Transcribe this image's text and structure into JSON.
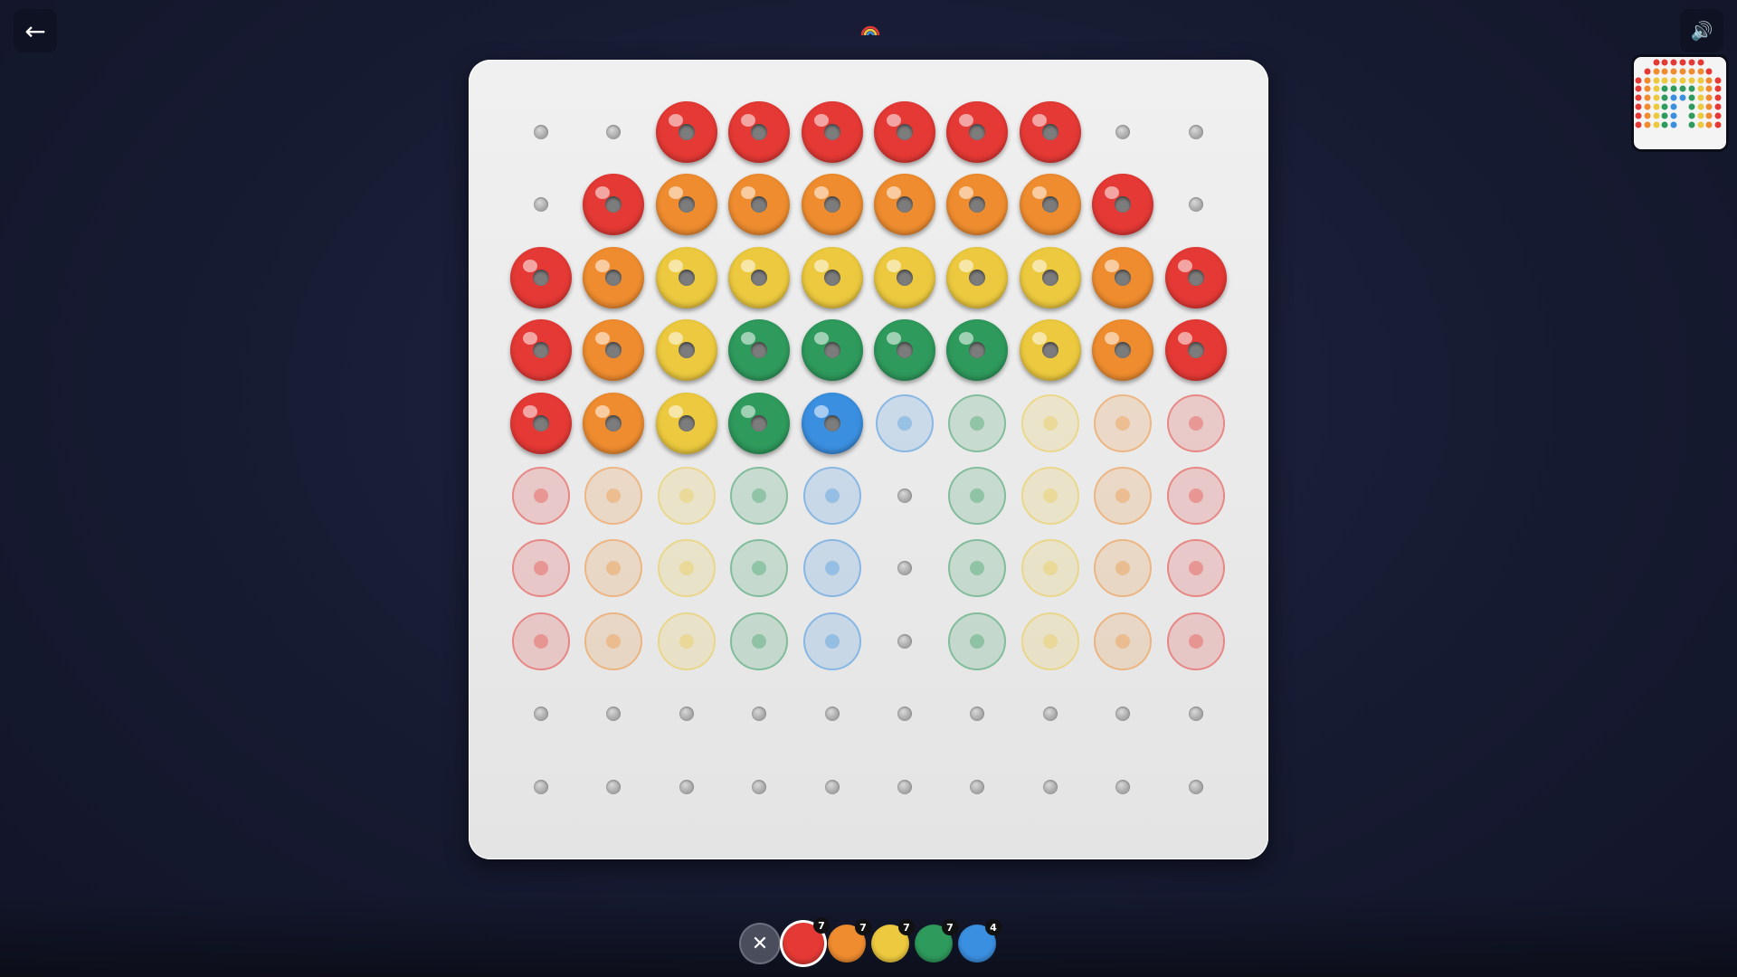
{
  "nav": {
    "back_label": "←",
    "sound_label": "🔊",
    "title_icon": "rainbow-icon"
  },
  "colors": {
    "red": "#e53935",
    "orange": "#ef8c2f",
    "yellow": "#ecc93e",
    "green": "#2e9a5c",
    "blue": "#3a8fe0"
  },
  "board": {
    "grid_size": [
      10,
      10
    ],
    "placed": [
      ". . R R R R R R . .",
      ". R O O O O O O R .",
      "R O Y Y Y Y Y Y O R",
      "R O Y G G G G Y O R",
      "R O Y G B . . . . .",
      ". . . . . . . . . .",
      ". . . . . . . . . .",
      ". . . . . . . . . .",
      ". . . . . . . . . .",
      ". . . . . . . . . ."
    ],
    "target": [
      ". . R R R R R R . .",
      ". R O O O O O O R .",
      "R O Y Y Y Y Y Y O R",
      "R O Y G G G G Y O R",
      "R O Y G B B G Y O R",
      "R O Y G B . G Y O R",
      "R O Y G B . G Y O R",
      "R O Y G B . G Y O R",
      ". . . . . . . . . .",
      ". . . . . . . . . ."
    ]
  },
  "palette": {
    "clear_label": "✕",
    "selected": "red",
    "items": [
      {
        "color": "red",
        "count": "7"
      },
      {
        "color": "orange",
        "count": "7"
      },
      {
        "color": "yellow",
        "count": "7"
      },
      {
        "color": "green",
        "count": "7"
      },
      {
        "color": "blue",
        "count": "4"
      }
    ]
  }
}
